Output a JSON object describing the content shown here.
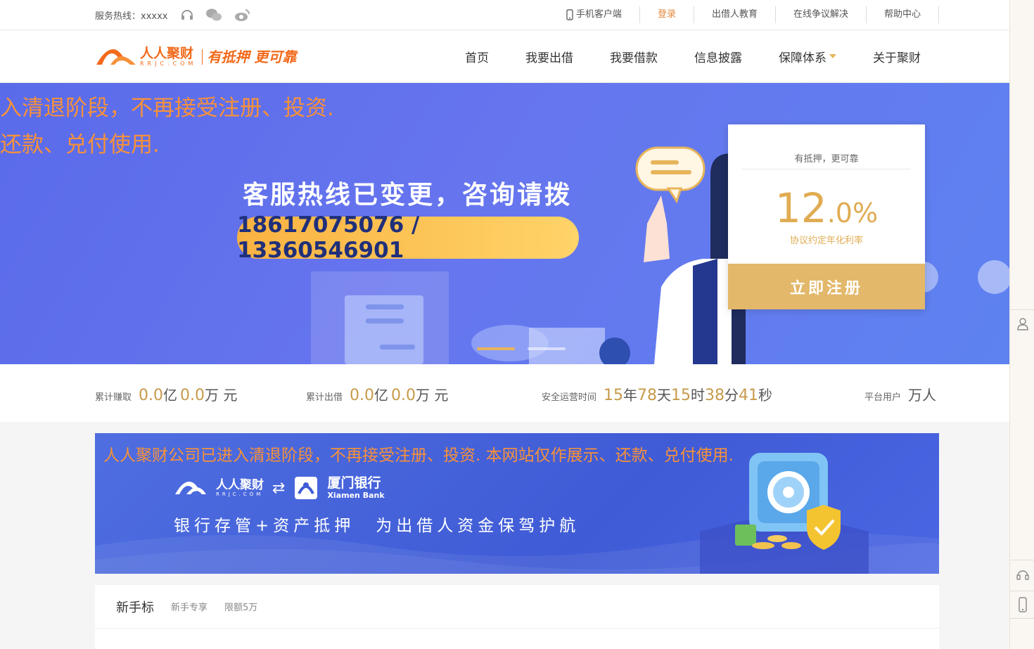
{
  "topbar": {
    "hotline": "服务热线：xxxxx",
    "links": [
      "手机客户端",
      "登录",
      "出借人教育",
      "在线争议解决",
      "帮助中心"
    ]
  },
  "nav": {
    "logo_cn": "人人聚财",
    "logo_en": "RRJC.COM",
    "logo_slogan": "有抵押 更可靠",
    "items": [
      "首页",
      "我要出借",
      "我要借款",
      "信息披露",
      "保障体系",
      "关于聚财"
    ]
  },
  "banner": {
    "notice_line1": "入清退阶段，不再接受注册、投资.",
    "notice_line2": "还款、兑付使用.",
    "title": "客服热线已变更，咨询请拨",
    "phones": "18617075076 / 13360546901"
  },
  "register_card": {
    "slogan": "有抵押，更可靠",
    "rate_int": "12",
    "rate_dec": ".0%",
    "rate_label": "协议约定年化利率",
    "button": "立即注册"
  },
  "stats": {
    "earned_label": "累计赚取",
    "earned_yi": "0.0",
    "earned_yi_unit": "亿",
    "earned_wan": "0.0",
    "earned_wan_unit": "万 元",
    "lent_label": "累计出借",
    "lent_yi": "0.0",
    "lent_yi_unit": "亿",
    "lent_wan": "0.0",
    "lent_wan_unit": "万 元",
    "uptime_label": "安全运营时间",
    "years": "15",
    "years_unit": "年",
    "days": "78",
    "days_unit": "天",
    "hours": "15",
    "hours_unit": "时",
    "minutes": "38",
    "minutes_unit": "分",
    "seconds": "41",
    "seconds_unit": "秒",
    "users_label": "平台用户",
    "users_unit": "万人"
  },
  "bank_banner": {
    "notice": "人人聚财公司已进入清退阶段，不再接受注册、投资. 本网站仅作展示、还款、兑付使用.",
    "partner_cn": "人人聚财",
    "partner_en": "RRJC.COM",
    "bank_cn": "厦门银行",
    "bank_en": "Xiamen Bank",
    "tagline1": "银行存管+资产抵押",
    "tagline2": "为出借人资金保驾护航"
  },
  "product": {
    "title": "新手标",
    "tag1": "新手专享",
    "tag2": "限额5万"
  },
  "colors": {
    "accent_orange": "#f26a1b",
    "gold": "#e3b86a",
    "banner_blue": "#6675ee"
  }
}
